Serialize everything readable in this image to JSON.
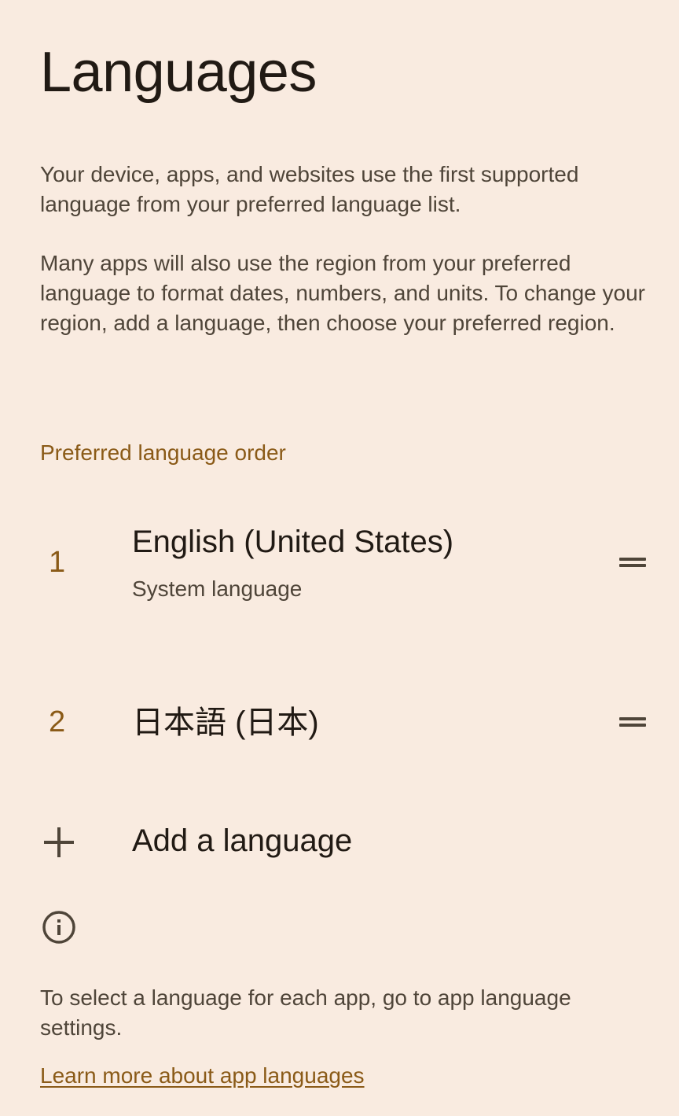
{
  "page": {
    "title": "Languages",
    "description_1": "Your device, apps, and websites use the first supported language from your preferred language list.",
    "description_2": "Many apps will also use the region from your preferred language to format dates, numbers, and units. To change your region, add a language, then choose your preferred region."
  },
  "preferred": {
    "header": "Preferred language order",
    "languages": [
      {
        "number": "1",
        "name": "English (United States)",
        "subtitle": "System language"
      },
      {
        "number": "2",
        "name": "日本語 (日本)",
        "subtitle": ""
      }
    ]
  },
  "add_language": {
    "label": "Add a language",
    "icon": "plus-icon"
  },
  "footer": {
    "info_icon": "info-icon",
    "text": "To select a language for each app, go to app language settings.",
    "link": "Learn more about app languages"
  },
  "colors": {
    "background": "#f9ebe0",
    "accent": "#8a5a17",
    "text_primary": "#211a14",
    "text_secondary": "#4f4539"
  }
}
